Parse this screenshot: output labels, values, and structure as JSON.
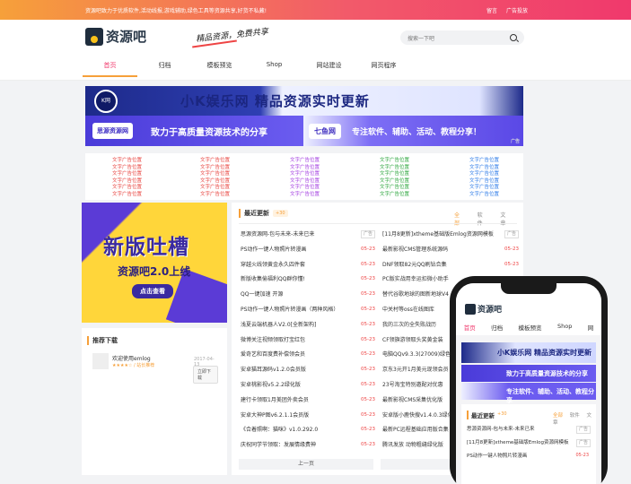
{
  "topbar": {
    "notice": "资源吧致力于优质软件,活动线报,游戏辅助,绿色工具等资源共享,好货不私藏!",
    "links": [
      "留言",
      "广告投放"
    ]
  },
  "header": {
    "logo_text": "资源吧",
    "slogan": "精品资源，免费共享",
    "search_placeholder": "搜索一下吧"
  },
  "nav": [
    "首页",
    "归档",
    "模板预览",
    "Shop",
    "网站建设",
    "网页程序"
  ],
  "banners": {
    "b1_badge": "K网",
    "b1_text": "小K娱乐网  精品资源实时更新",
    "b2_logo": "思源资源网",
    "b2_text": "致力于高质量资源技术的分享",
    "b3_logo": "七鱼网",
    "b3_text": "专注软件、辅助、活动、教程分享！",
    "ad": "广告"
  },
  "text_ads": {
    "label": "文字广告位置",
    "colors": [
      "#e8413d",
      "#e8413d",
      "#a23be0",
      "#2aa53b",
      "#2b7ae8"
    ]
  },
  "promo": {
    "title": "新版吐槽",
    "subtitle": "资源吧2.0上线",
    "button": "点击查看"
  },
  "recommend": {
    "heading": "推荐下载",
    "item_name": "欢迎使用emlog",
    "item_rating": "★★★★☆ / 站长推荐",
    "item_date": "2017-04-13",
    "item_button": "立即下载"
  },
  "news": {
    "heading": "最近更新",
    "count": "+30",
    "tabs": [
      "全部",
      "软件",
      "文章"
    ],
    "left": [
      {
        "t": "思源资源网-包与未来-未来已来",
        "d": "广告"
      },
      {
        "t": "PS动作一键人物照片转漫画",
        "d": "05-23"
      },
      {
        "t": "穿越火线领黄金永久四件套",
        "d": "05-23"
      },
      {
        "t": "新版收集偷福利QQ群你懂!",
        "d": "05-23"
      },
      {
        "t": "QQ一键加速 开源",
        "d": "05-23"
      },
      {
        "t": "PS动作一键人物照片转漫画（两种风格）",
        "d": "05-23"
      },
      {
        "t": "浅夏云端机器人V2.0[全新架构]",
        "d": "05-23"
      },
      {
        "t": "微博关注视频领取打宝红包",
        "d": "05-23"
      },
      {
        "t": "爱奇艺和百度费补偿领会员",
        "d": "05-23"
      },
      {
        "t": "安卓猫耳源码v1.2.0会员版",
        "d": "05-23"
      },
      {
        "t": "安卓桃影视v5.2.2绿化版",
        "d": "05-23"
      },
      {
        "t": "建行卡领取1月美团外卖会员",
        "d": "05-23"
      },
      {
        "t": "安卓大神P图v6.2.1.1会员版",
        "d": "05-23"
      },
      {
        "t": "《合着照啊：猫咪》v1.0.292.0",
        "d": "05-23"
      },
      {
        "t": "庆祝同学节领取：发展情缘费神",
        "d": "05-23"
      }
    ],
    "right": [
      {
        "t": "[11月8更新]xtheme基础版Emlog资源网模板",
        "d": "广告"
      },
      {
        "t": "最新影视CMS管理系统源码",
        "d": "05-23"
      },
      {
        "t": "DNF领取82元QQ刷钻合集",
        "d": "05-23"
      },
      {
        "t": "PC版实战用幸运扣微小助手",
        "d": "05-23"
      },
      {
        "t": "替代谷歌地球的图新地球V4",
        "d": "05-23"
      },
      {
        "t": "中关村等oss在线图库",
        "d": "05-23"
      },
      {
        "t": "我的三次的全失败战历",
        "d": "05-23"
      },
      {
        "t": "CF领旗游领取头奖黄金装",
        "d": "05-23"
      },
      {
        "t": "电脑QQv9.3.3(27009)绿色",
        "d": "05-23"
      },
      {
        "t": "京东3元开1月美元现领会员",
        "d": "05-23"
      },
      {
        "t": "23号淘宝特别邀配对优惠",
        "d": "05-23"
      },
      {
        "t": "最新影视CMS采集优化版",
        "d": "05-23"
      },
      {
        "t": "安卓版小鹿快搜v1.4.0.3绿化",
        "d": "05-23"
      },
      {
        "t": "最新PC远程基础应用版合集",
        "d": "05-23"
      },
      {
        "t": "腾讯发放 动物粗缝绿化版",
        "d": "05-23"
      }
    ],
    "prev": "上一页",
    "next": "下一"
  },
  "phone": {
    "logo": "资源吧",
    "nav": [
      "首页",
      "归档",
      "模板预览",
      "Shop",
      "网"
    ],
    "b1": "小K娱乐网  精品资源实时更新",
    "b2": "致力于高质量资源技术的分享",
    "b3": "专注软件、辅助、活动、教程分享",
    "heading": "最近更新",
    "count": "+30",
    "tabs": [
      "全部",
      "软件",
      "文章"
    ],
    "rows": [
      {
        "t": "思源资源网-包与未来-未来已来",
        "d": "广告"
      },
      {
        "t": "[11月8更新]xtheme基础版Emlog资源网模板",
        "d": "广告"
      },
      {
        "t": "PS动作一键人物照片转漫画",
        "d": "05-23"
      }
    ]
  }
}
